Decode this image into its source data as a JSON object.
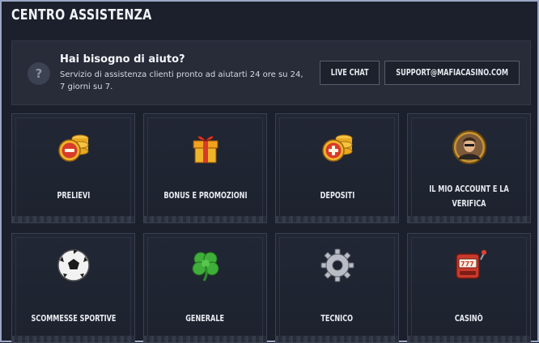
{
  "header": {
    "title": "CENTRO ASSISTENZA"
  },
  "help": {
    "icon": "question-icon",
    "title": "Hai bisogno di aiuto?",
    "description": "Servizio di assistenza clienti pronto ad aiutarti 24 ore su 24, 7 giorni su 7.",
    "live_chat_label": "LIVE CHAT",
    "email_label": "SUPPORT@MAFIACASINO.COM"
  },
  "categories": [
    {
      "label": "PRELIEVI",
      "icon": "coins-minus-icon"
    },
    {
      "label": "BONUS E PROMOZIONI",
      "icon": "gift-icon"
    },
    {
      "label": "DEPOSITI",
      "icon": "coins-plus-icon"
    },
    {
      "label": "IL MIO ACCOUNT E LA VERIFICA",
      "icon": "avatar-icon"
    },
    {
      "label": "SCOMMESSE SPORTIVE",
      "icon": "soccer-ball-icon"
    },
    {
      "label": "GENERALE",
      "icon": "clover-icon"
    },
    {
      "label": "TECNICO",
      "icon": "gear-icon"
    },
    {
      "label": "CASINÒ",
      "icon": "slot-machine-icon"
    }
  ],
  "colors": {
    "background": "#1b202c",
    "panel": "#272c38",
    "card": "#222735",
    "border": "#9aa6c4",
    "gold": "#f0b429",
    "red": "#d33a2c"
  }
}
